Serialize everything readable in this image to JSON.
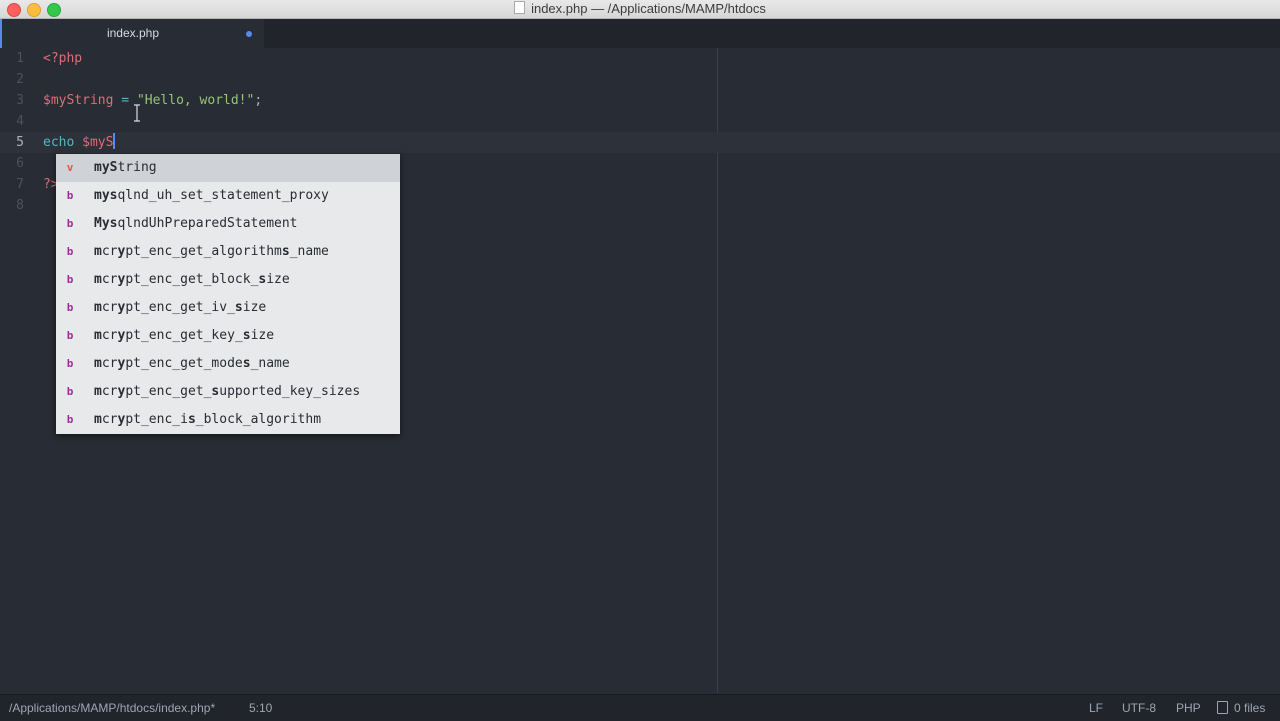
{
  "window": {
    "title": "index.php — /Applications/MAMP/htdocs",
    "accent_color": "#568af2"
  },
  "tabs": [
    {
      "label": "index.php",
      "modified": true
    }
  ],
  "editor": {
    "lines": [
      {
        "number": "1",
        "tokens": [
          {
            "type": "tag",
            "text": "<?php"
          }
        ]
      },
      {
        "number": "2",
        "tokens": []
      },
      {
        "number": "3",
        "tokens": [
          {
            "type": "var",
            "text": "$myString"
          },
          {
            "type": "plain",
            "text": " "
          },
          {
            "type": "op",
            "text": "="
          },
          {
            "type": "plain",
            "text": " "
          },
          {
            "type": "str",
            "text": "\"Hello, world!\""
          },
          {
            "type": "plain",
            "text": ";"
          }
        ]
      },
      {
        "number": "4",
        "tokens": []
      },
      {
        "number": "5",
        "tokens": [
          {
            "type": "kw",
            "text": "echo"
          },
          {
            "type": "plain",
            "text": " "
          },
          {
            "type": "var",
            "text": "$myS"
          }
        ],
        "cursor": true
      },
      {
        "number": "6",
        "tokens": []
      },
      {
        "number": "7",
        "tokens": [
          {
            "type": "tag",
            "text": "?>"
          }
        ]
      },
      {
        "number": "8",
        "tokens": []
      }
    ]
  },
  "autocomplete": {
    "items": [
      {
        "type": "v",
        "label": "myString",
        "bold": "myS"
      },
      {
        "type": "b",
        "label": "mysqlnd_uh_set_statement_proxy",
        "bold": "mys"
      },
      {
        "type": "b",
        "label": "MysqlndUhPreparedStatement",
        "bold": "Mys"
      },
      {
        "type": "b",
        "label": "mcrypt_enc_get_algorithms_name",
        "bold": "m,y,s"
      },
      {
        "type": "b",
        "label": "mcrypt_enc_get_block_size",
        "bold": "m,y,s"
      },
      {
        "type": "b",
        "label": "mcrypt_enc_get_iv_size",
        "bold": "m,y,s"
      },
      {
        "type": "b",
        "label": "mcrypt_enc_get_key_size",
        "bold": "m,y,s"
      },
      {
        "type": "b",
        "label": "mcrypt_enc_get_modes_name",
        "bold": "m,y,s"
      },
      {
        "type": "b",
        "label": "mcrypt_enc_get_supported_key_sizes",
        "bold": "m,y,s"
      },
      {
        "type": "b",
        "label": "mcrypt_enc_is_block_algorithm",
        "bold": "m,y,s"
      }
    ],
    "selected_index": 0
  },
  "statusbar": {
    "path": "/Applications/MAMP/htdocs/index.php*",
    "position": "5:10",
    "line_ending": "LF",
    "encoding": "UTF-8",
    "grammar": "PHP",
    "files": "0 files"
  }
}
